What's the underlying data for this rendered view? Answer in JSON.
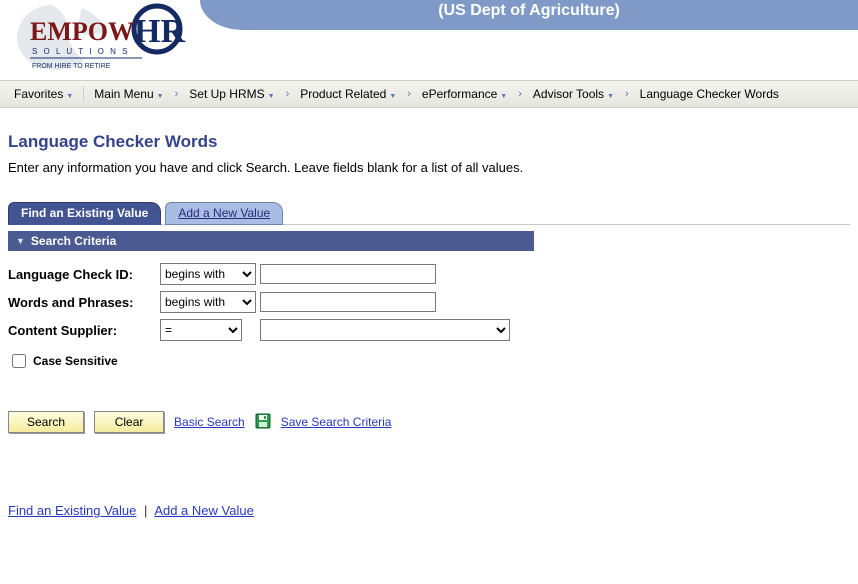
{
  "header": {
    "org_title": "(US Dept of Agriculture)",
    "logo_main": "EMPOW",
    "logo_accent": "HR",
    "logo_sub1": "S O L U T I O N S",
    "logo_sub2": "FROM HIRE TO RETIRE"
  },
  "breadcrumb": {
    "favorites": "Favorites",
    "items": [
      "Main Menu",
      "Set Up HRMS",
      "Product Related",
      "ePerformance",
      "Advisor Tools",
      "Language Checker Words"
    ]
  },
  "page": {
    "title": "Language Checker Words",
    "instructions": "Enter any information you have and click Search. Leave fields blank for a list of all values."
  },
  "tabs": {
    "active": "Find an Existing Value",
    "inactive": "Add a New Value"
  },
  "section": {
    "title": "Search Criteria"
  },
  "form": {
    "rows": [
      {
        "label": "Language Check ID:",
        "op": "begins with",
        "value": ""
      },
      {
        "label": "Words and Phrases:",
        "op": "begins with",
        "value": ""
      },
      {
        "label": "Content Supplier:",
        "op": "=",
        "value": ""
      }
    ],
    "case_sensitive_label": "Case Sensitive",
    "case_sensitive": false
  },
  "actions": {
    "search": "Search",
    "clear": "Clear",
    "basic_search": "Basic Search",
    "save_criteria": "Save Search Criteria"
  },
  "bottom_nav": {
    "existing": "Find an Existing Value",
    "add": "Add a New Value"
  }
}
